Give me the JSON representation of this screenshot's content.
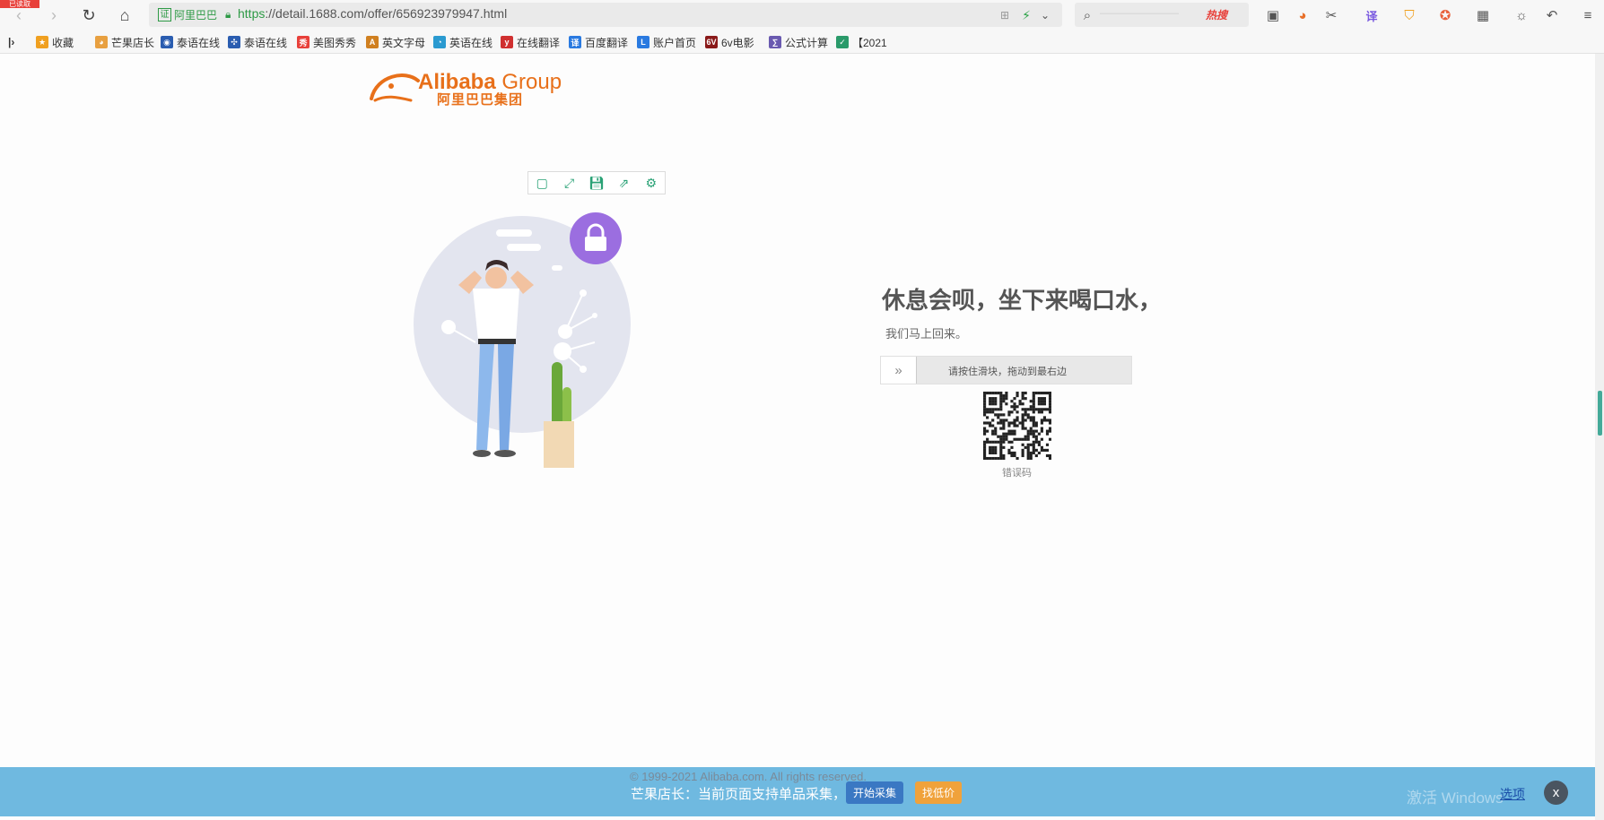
{
  "browser": {
    "badge": "已读取",
    "cert_label": "阿里巴巴",
    "cert_box": "证",
    "url_scheme": "https",
    "url_rest": "://detail.1688.com/offer/656923979947.html",
    "search_placeholder": "————————",
    "hot_label": "热搜"
  },
  "bookmarks": [
    {
      "label": "收藏",
      "icon": "star-icon",
      "color": "#f0a020"
    },
    {
      "label": "芒果店长",
      "icon": "mango-icon",
      "color": "#e8a040"
    },
    {
      "label": "泰语在线",
      "icon": "globe-icon",
      "color": "#2a5db0"
    },
    {
      "label": "泰语在线",
      "icon": "network-icon",
      "color": "#2a5db0"
    },
    {
      "label": "美图秀秀",
      "icon": "meitu-icon",
      "color": "#e8403a"
    },
    {
      "label": "英文字母",
      "icon": "letter-icon",
      "color": "#d08020"
    },
    {
      "label": "英语在线",
      "icon": "chat-icon",
      "color": "#2a9ad0"
    },
    {
      "label": "在线翻译",
      "icon": "y-icon",
      "color": "#d03030"
    },
    {
      "label": "百度翻译",
      "icon": "translate-icon",
      "color": "#2a7ae0"
    },
    {
      "label": "账户首页",
      "icon": "l-icon",
      "color": "#2a7ae0"
    },
    {
      "label": "6v电影",
      "icon": "6v-icon",
      "color": "#8a1a1a"
    },
    {
      "label": "公式计算",
      "icon": "calc-icon",
      "color": "#6a5ab0"
    },
    {
      "label": "【2021",
      "icon": "check-icon",
      "color": "#2a9a6a"
    }
  ],
  "page": {
    "logo_en": "Alibaba",
    "logo_group": "Group",
    "logo_cn": "阿里巴巴集团",
    "title": "休息会呗，坐下来喝口水，",
    "subtitle": "我们马上回来。",
    "slider_text": "请按住滑块，拖动到最右边",
    "qr_label": "错误码",
    "copyright": "© 1999-2021 Alibaba.com. All rights reserved."
  },
  "extension_bar": {
    "message": "芒果店长：当前页面支持单品采集，",
    "start_button": "开始采集",
    "price_button": "找低价",
    "options_link": "选项",
    "close": "x",
    "watermark": "激活 Windows"
  },
  "colors": {
    "accent": "#e8701a",
    "bar": "#6fb9e0",
    "ok": "#2e9a46",
    "lock": "#9b6ee0"
  }
}
